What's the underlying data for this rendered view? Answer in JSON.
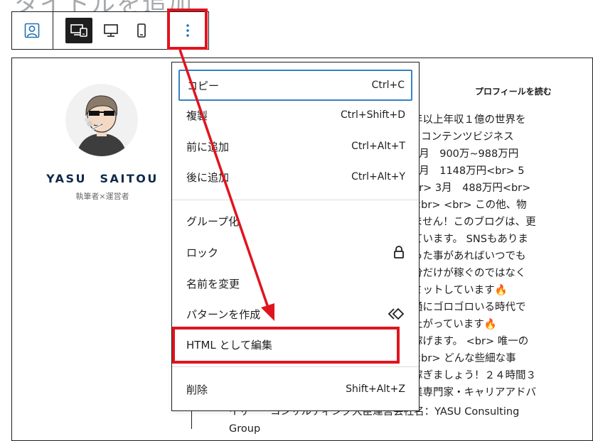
{
  "page": {
    "title_fragment": "タイトルを追加"
  },
  "toolbar": {
    "block_icon": "user-profile-icon",
    "devices": [
      {
        "icon": "desktop-tablet-mobile-icon",
        "state": "active"
      },
      {
        "icon": "desktop-icon"
      },
      {
        "icon": "mobile-icon"
      }
    ],
    "options_icon": "vertical-ellipsis-icon"
  },
  "profile": {
    "name": "YASU　SAITOU",
    "role": "執筆者×運営者",
    "link_label": "プロフィールを読む",
    "text_lines": [
      "年以上年収１億の世界を",
      "×コンテンツビジネス",
      "8月　900万~988万円",
      "6月　1148万円<br> 5",
      "br> 3月　488万円<br>",
      "<br> <br> この他、物",
      "ません！このブログは、更",
      "ています。 SNSもありま",
      "った事があればいつでも",
      "分だけが稼ぐのではなく",
      "ミットしています",
      "通にゴロゴロいる時代で",
      "上がっています",
      "稼げます。 <br> 唯一の",
      "<br> どんな些細な事",
      "稼ぎましょう！２４時間３",
      "業専門家・キャリアアドバ"
    ],
    "fire_lines": [
      10,
      12
    ],
    "tail_lines": [
      "イザー　コンサルティング大臣運営会社名：YASU Consulting",
      "Group"
    ]
  },
  "menu": {
    "groups": [
      [
        {
          "label": "コピー",
          "shortcut": "Ctrl+C",
          "state": "focused"
        },
        {
          "label": "複製",
          "shortcut": "Ctrl+Shift+D"
        },
        {
          "label": "前に追加",
          "shortcut": "Ctrl+Alt+T"
        },
        {
          "label": "後に追加",
          "shortcut": "Ctrl+Alt+Y"
        }
      ],
      [
        {
          "label": "グループ化"
        },
        {
          "label": "ロック",
          "icon": "lock-icon"
        },
        {
          "label": "名前を変更"
        },
        {
          "label": "パターンを作成",
          "icon": "pattern-diamond-icon"
        },
        {
          "label": "HTML として編集",
          "state": "highlighted"
        }
      ],
      [
        {
          "label": "削除",
          "shortcut": "Shift+Alt+Z"
        }
      ]
    ]
  },
  "colors": {
    "annotation_red": "#e0141e",
    "focus_blue": "#3582c4",
    "name_navy": "#0d2a4a",
    "icon_blue": "#2271b1"
  }
}
